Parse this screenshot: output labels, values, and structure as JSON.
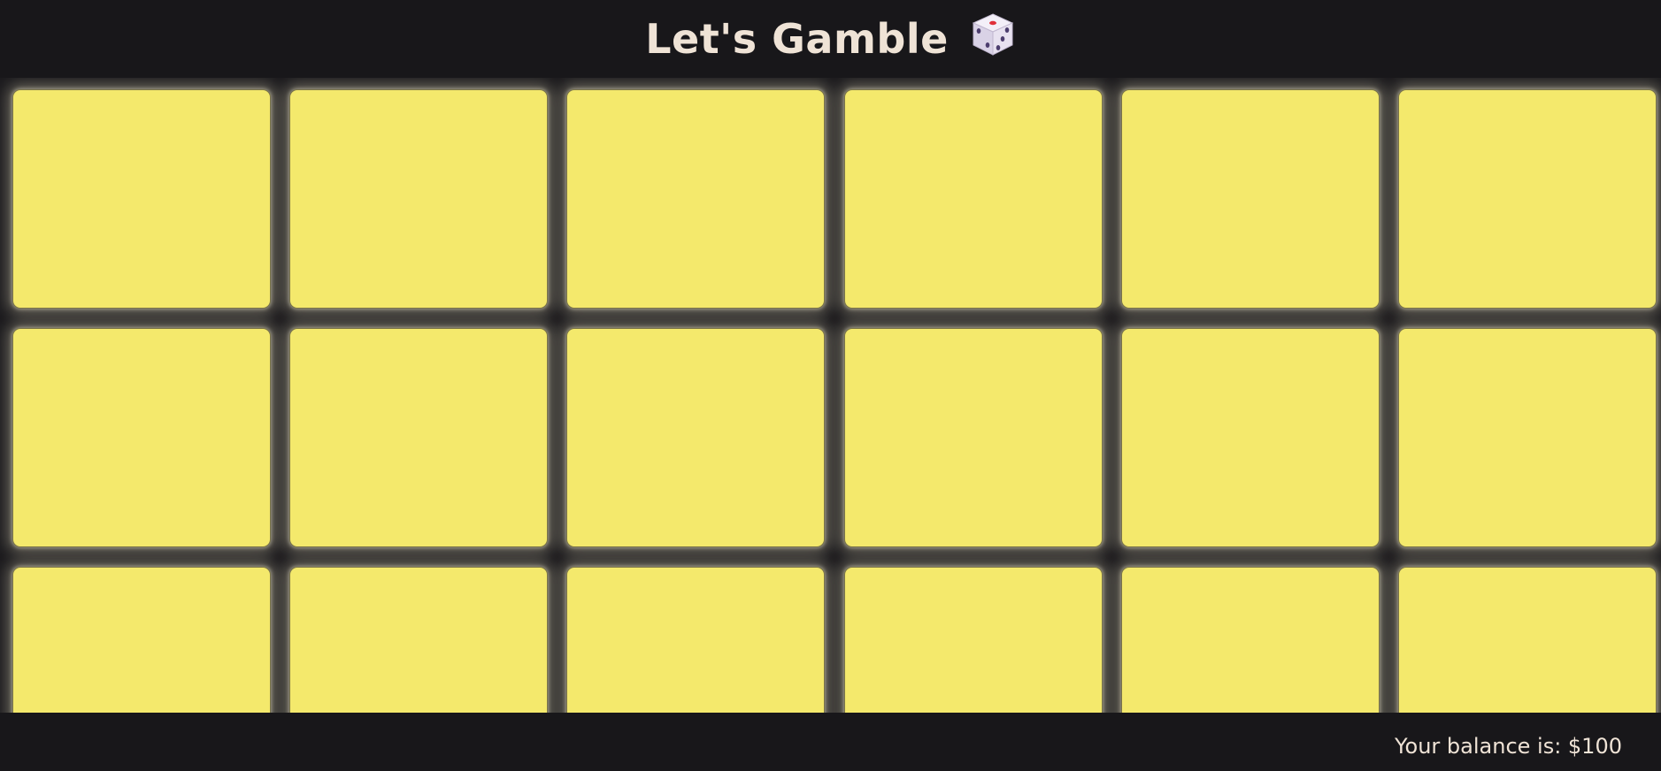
{
  "header": {
    "title": "Let's Gamble",
    "icon": "dice-icon"
  },
  "board": {
    "rows": 3,
    "columns": 6,
    "tile_color": "#f4e96c",
    "tiles": [
      {
        "row": 1,
        "col": 1
      },
      {
        "row": 1,
        "col": 2
      },
      {
        "row": 1,
        "col": 3
      },
      {
        "row": 1,
        "col": 4
      },
      {
        "row": 1,
        "col": 5
      },
      {
        "row": 1,
        "col": 6
      },
      {
        "row": 2,
        "col": 1
      },
      {
        "row": 2,
        "col": 2
      },
      {
        "row": 2,
        "col": 3
      },
      {
        "row": 2,
        "col": 4
      },
      {
        "row": 2,
        "col": 5
      },
      {
        "row": 2,
        "col": 6
      },
      {
        "row": 3,
        "col": 1
      },
      {
        "row": 3,
        "col": 2
      },
      {
        "row": 3,
        "col": 3
      },
      {
        "row": 3,
        "col": 4
      },
      {
        "row": 3,
        "col": 5
      },
      {
        "row": 3,
        "col": 6
      }
    ]
  },
  "footer": {
    "balance_text": "Your balance is: $100"
  },
  "colors": {
    "background": "#18171a",
    "text": "#efe3d6",
    "tile": "#f4e96c"
  }
}
